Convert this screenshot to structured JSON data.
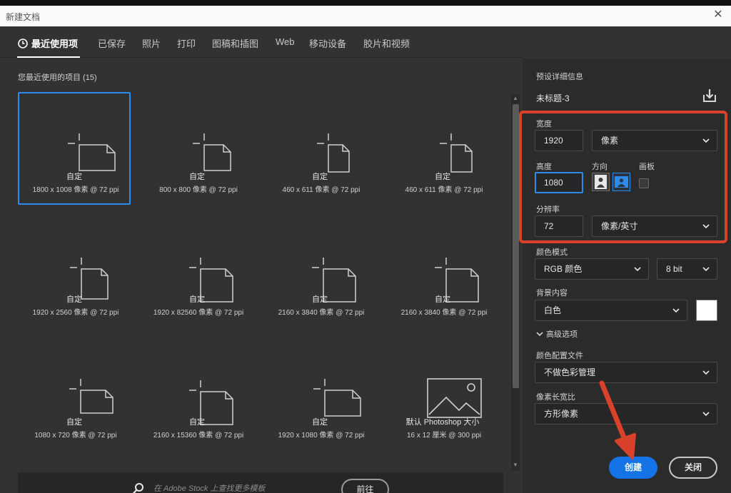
{
  "window": {
    "title": "新建文档",
    "close_glyph": "✕"
  },
  "tabs": [
    {
      "label": "最近使用项",
      "icon": "clock-icon",
      "active": true
    },
    {
      "label": "已保存"
    },
    {
      "label": "照片"
    },
    {
      "label": "打印"
    },
    {
      "label": "图稿和插图"
    },
    {
      "label": "Web"
    },
    {
      "label": "移动设备"
    },
    {
      "label": "胶片和视频"
    }
  ],
  "recent": {
    "section_label": "您最近使用的项目 (15)",
    "items": [
      {
        "name": "自定",
        "dims": "1800 x 1008 像素 @ 72 ppi",
        "orientation": "landscape",
        "selected": true
      },
      {
        "name": "自定",
        "dims": "800 x 800 像素 @ 72 ppi",
        "orientation": "square"
      },
      {
        "name": "自定",
        "dims": "460 x 611 像素 @ 72 ppi",
        "orientation": "portrait-small"
      },
      {
        "name": "自定",
        "dims": "460 x 611 像素 @ 72 ppi",
        "orientation": "portrait-small"
      },
      {
        "name": "自定",
        "dims": "1920 x 2560 像素 @ 72 ppi",
        "orientation": "portrait"
      },
      {
        "name": "自定",
        "dims": "1920 x 82560 像素 @ 72 ppi",
        "orientation": "portrait-tall"
      },
      {
        "name": "自定",
        "dims": "2160 x 3840 像素 @ 72 ppi",
        "orientation": "portrait-tall"
      },
      {
        "name": "自定",
        "dims": "2160 x 3840 像素 @ 72 ppi",
        "orientation": "portrait-tall"
      },
      {
        "name": "自定",
        "dims": "1080 x 720 像素 @ 72 ppi",
        "orientation": "landscape-small"
      },
      {
        "name": "自定",
        "dims": "2160 x 15360 像素 @ 72 ppi",
        "orientation": "portrait-tall"
      },
      {
        "name": "自定",
        "dims": "1920 x 1080 像素 @ 72 ppi",
        "orientation": "landscape"
      },
      {
        "name": "默认 Photoshop 大小",
        "dims": "16 x 12 厘米 @ 300 ppi",
        "orientation": "image-icon"
      }
    ]
  },
  "search": {
    "placeholder": "在 Adobe Stock 上查找更多模板",
    "go_label": "前往"
  },
  "preset": {
    "section_label": "预设详细信息",
    "name": "未标题-3",
    "width_label": "宽度",
    "width_value": "1920",
    "width_unit": "像素",
    "height_label": "高度",
    "height_value": "1080",
    "orientation_label": "方向",
    "artboard_label": "画板",
    "resolution_label": "分辨率",
    "resolution_value": "72",
    "resolution_unit": "像素/英寸",
    "color_mode_label": "颜色模式",
    "color_mode_value": "RGB 颜色",
    "bit_depth_value": "8 bit",
    "background_label": "背景内容",
    "background_value": "白色",
    "background_color": "#ffffff",
    "advanced_label": "高级选项",
    "color_profile_label": "颜色配置文件",
    "color_profile_value": "不做色彩管理",
    "pixel_aspect_label": "像素长宽比",
    "pixel_aspect_value": "方形像素"
  },
  "buttons": {
    "create": "创建",
    "close": "关闭"
  },
  "colors": {
    "accent": "#1473e6",
    "selection": "#2d8ceb",
    "annotation": "#d9412a"
  }
}
